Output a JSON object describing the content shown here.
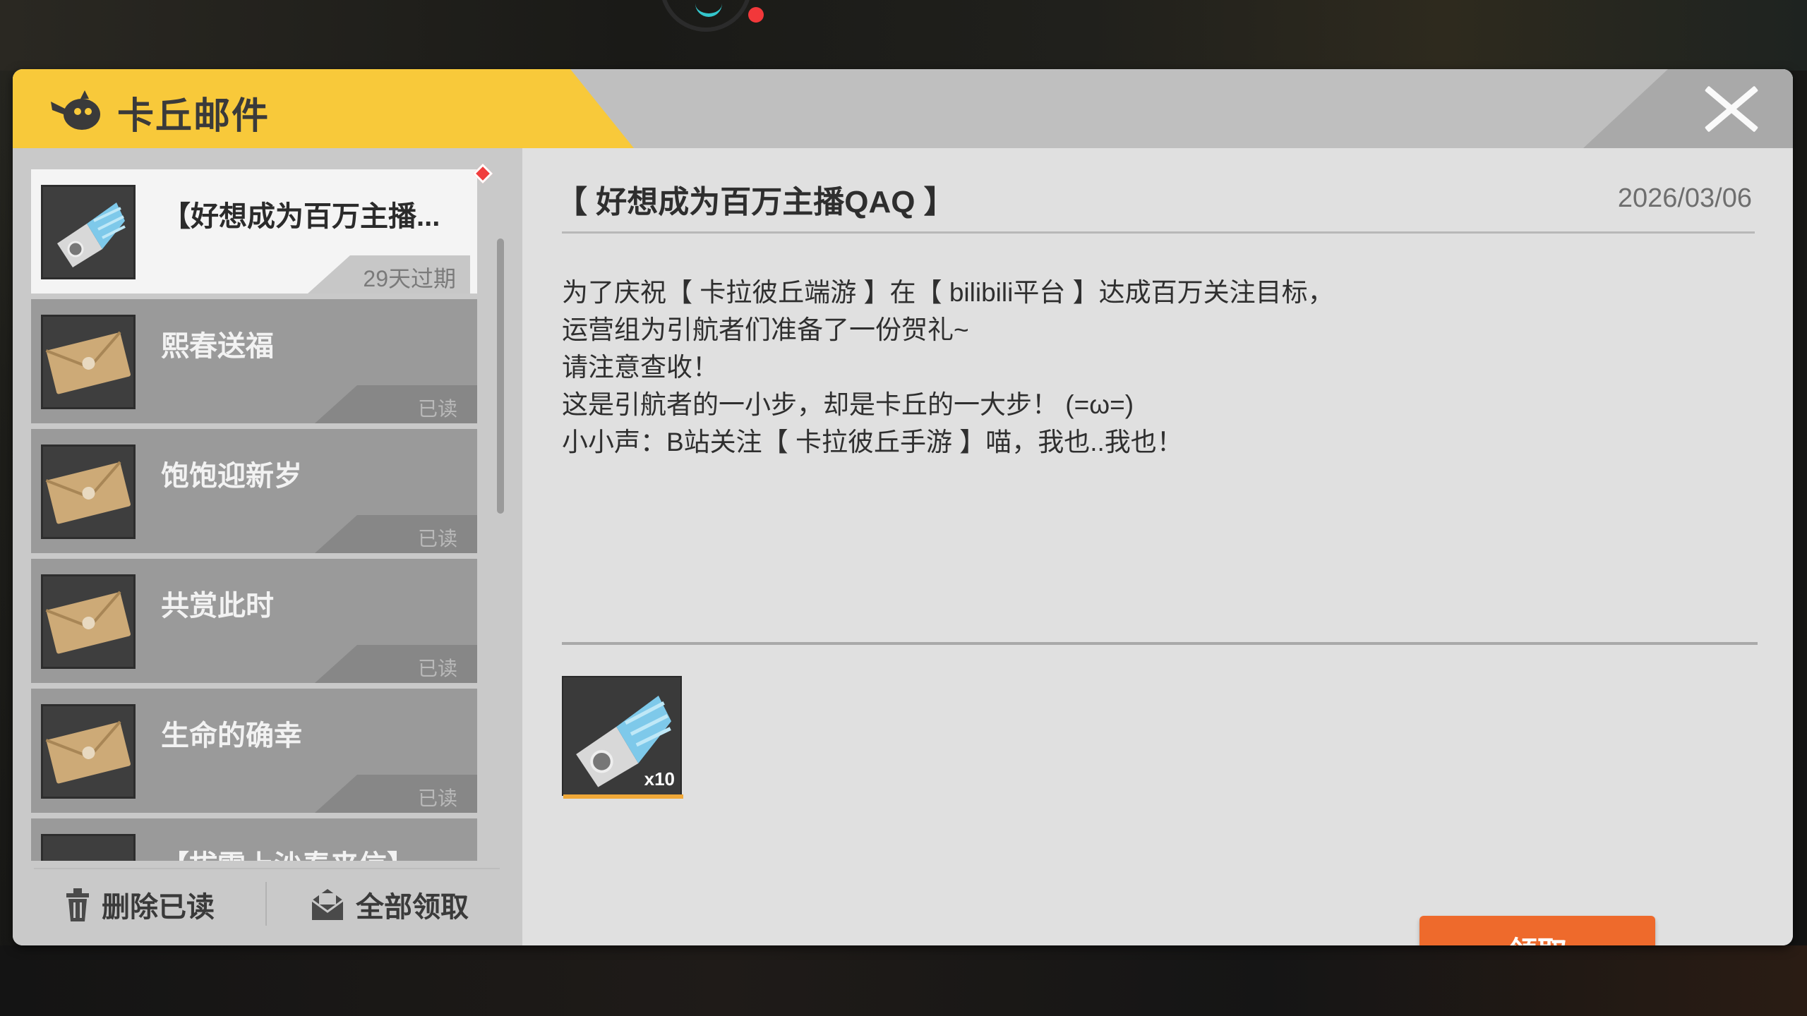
{
  "header": {
    "title": "卡丘邮件"
  },
  "mails": [
    {
      "title": "【好想成为百万主播...",
      "tag": "29天过期",
      "selected": true,
      "icon": "ticket-icon"
    },
    {
      "title": "熙春送福",
      "tag": "已读",
      "icon": "envelope-icon"
    },
    {
      "title": "饱饱迎新岁",
      "tag": "已读",
      "icon": "envelope-icon"
    },
    {
      "title": "共赏此时",
      "tag": "已读",
      "icon": "envelope-icon"
    },
    {
      "title": "生命的确幸",
      "tag": "已读",
      "icon": "envelope-icon"
    },
    {
      "title": "【拔雪上沙春来信】",
      "tag": "",
      "icon": "envelope-icon"
    }
  ],
  "bottom": {
    "delete_read": "删除已读",
    "claim_all": "全部领取"
  },
  "detail": {
    "title": "【 好想成为百万主播QAQ 】",
    "date": "2026/03/06",
    "body": [
      "为了庆祝【 卡拉彼丘端游 】在【 bilibili平台 】达成百万关注目标，",
      "运营组为引航者们准备了一份贺礼~",
      "请注意查收！",
      "这是引航者的一小步，却是卡丘的一大步！ (=ω=)",
      "小小声：B站关注【 卡拉彼丘手游 】喵，我也..我也！"
    ],
    "reward_qty": "x10",
    "claim_label": "领取"
  },
  "colors": {
    "accent_yellow": "#f8c93a",
    "claim_orange": "#ee6a2c",
    "new_dot": "#f03d3d"
  }
}
